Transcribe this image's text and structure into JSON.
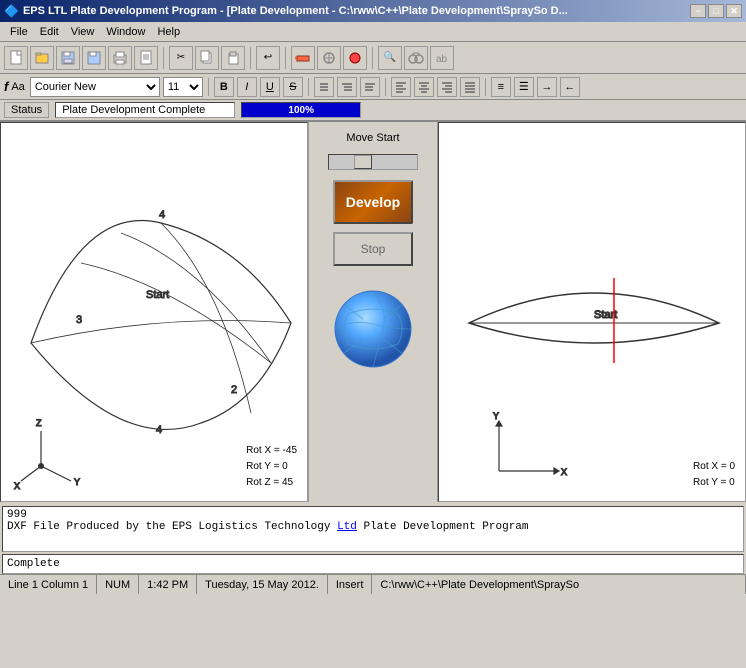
{
  "titlebar": {
    "icon": "app-icon",
    "title": "EPS LTL Plate Development Program - [Plate Development - C:\\rww\\C++\\Plate Development\\SpraySo D...",
    "min_btn": "−",
    "max_btn": "□",
    "close_btn": "✕"
  },
  "menubar": {
    "items": [
      "File",
      "Edit",
      "View",
      "Window",
      "Help"
    ]
  },
  "toolbar": {
    "buttons": [
      "new",
      "open",
      "save",
      "print",
      "preview",
      "cut",
      "copy",
      "paste",
      "undo",
      "redo",
      "find",
      "replace"
    ]
  },
  "formatbar": {
    "font_icon": "f",
    "size_label": "Aa",
    "font_name": "Courier New",
    "font_size": "11",
    "bold": "B",
    "italic": "I",
    "underline": "U",
    "strikethrough": "S",
    "align_buttons": [
      "align-left",
      "align-center",
      "align-right",
      "justify"
    ]
  },
  "status_top": {
    "label": "Status",
    "text": "Plate Development Complete",
    "progress": "100%",
    "progress_value": 100
  },
  "left_panel": {
    "axes": {
      "rot_x": "Rot X = -45",
      "rot_y": "Rot Y = 0",
      "rot_z": "Rot Z = 45"
    },
    "start_label": "Start",
    "numbers": [
      "4",
      "3",
      "2",
      "4"
    ]
  },
  "center_panel": {
    "move_start": "Move Start",
    "develop_label": "Develop",
    "stop_label": "Stop"
  },
  "right_panel": {
    "axes": {
      "rot_x": "Rot X = 0",
      "rot_y": "Rot Y = 0"
    },
    "start_label": "Start"
  },
  "text_output": {
    "line1": "999",
    "line2_prefix": "DXF File Produced by the EPS Logistics Technology ",
    "line2_highlight": "Ltd",
    "line2_suffix": " Plate Development Program"
  },
  "input_line": {
    "value": "Complete"
  },
  "statusbar": {
    "position": "Line 1  Column 1",
    "num": "NUM",
    "time": "1:42 PM",
    "date": "Tuesday, 15 May 2012.",
    "mode": "Insert",
    "path": "C:\\rww\\C++\\Plate Development\\SpraySo"
  }
}
